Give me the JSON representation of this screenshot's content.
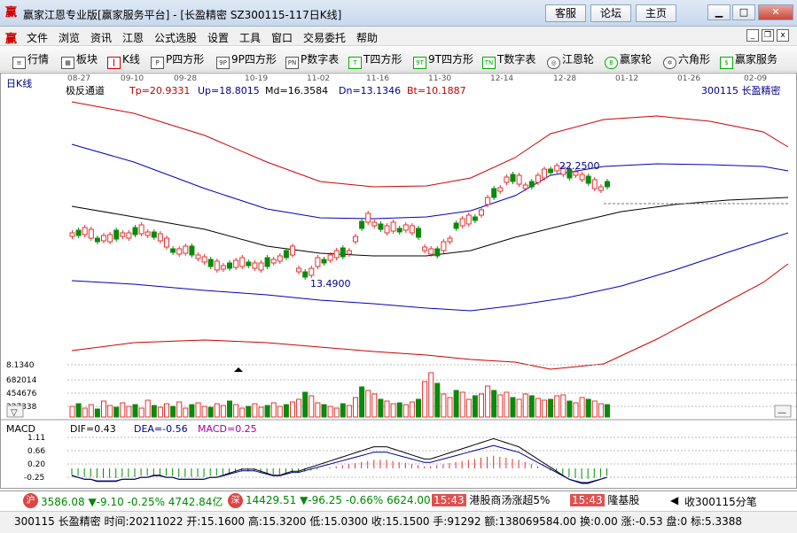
{
  "window": {
    "title": "赢家江恩专业版[赢家服务平台] - [长盈精密  SZ300115-117日K线]",
    "buttons": [
      "客服",
      "论坛",
      "主页"
    ]
  },
  "menu": [
    "文件",
    "浏览",
    "资讯",
    "江恩",
    "公式选股",
    "设置",
    "工具",
    "窗口",
    "交易委托",
    "帮助"
  ],
  "toolbar": [
    {
      "icon": "list-icon",
      "label": "行情"
    },
    {
      "icon": "grid-icon",
      "label": "板块"
    },
    {
      "icon": "candlestick-icon",
      "label": "K线"
    },
    {
      "icon": "p-box-icon",
      "label": "P四方形"
    },
    {
      "icon": "9p-box-icon",
      "label": "9P四方形"
    },
    {
      "icon": "pn-table-icon",
      "label": "P数字表"
    },
    {
      "icon": "t-box-icon",
      "label": "T四方形"
    },
    {
      "icon": "9t-box-icon",
      "label": "9T四方形"
    },
    {
      "icon": "tn-table-icon",
      "label": "T数字表"
    },
    {
      "icon": "wheel-icon",
      "label": "江恩轮"
    },
    {
      "icon": "winner-wheel-icon",
      "label": "赢家轮"
    },
    {
      "icon": "hexagon-icon",
      "label": "六角形"
    },
    {
      "icon": "dollar-icon",
      "label": "赢家服务"
    }
  ],
  "chart": {
    "period_label": "日K线",
    "indicator_name": "极反通道",
    "tp": "Tp=20.9331",
    "up": "Up=18.8015",
    "md": "Md=16.3584",
    "dn": "Dn=13.1346",
    "bt": "Bt=10.1887",
    "stock": "300115  长盈精密",
    "dates": [
      "08-27",
      "09-10",
      "09-28",
      "10-19",
      "11-02",
      "11-16",
      "11-30",
      "12-14",
      "12-28",
      "01-12",
      "01-26",
      "02-09"
    ],
    "high_label": "22.2500",
    "low_label": "13.4900",
    "volume_ticks": [
      "8.1340",
      "682014",
      "454676",
      "227338"
    ],
    "macd_title": "MACD",
    "dif": "DIF=0.43",
    "dea": "DEA=-0.56",
    "macd": "MACD=0.25",
    "macd_ticks": [
      "1.11",
      "0.66",
      "0.20",
      "-0.25"
    ]
  },
  "index_bar": {
    "sh_badge": "沪",
    "sh": "3586.08 ▼-9.10 -0.25% 4742.84亿",
    "sz_badge": "深",
    "sz": "14429.51 ▼-96.25 -0.66% 6624.00",
    "news1_time": "15:43",
    "news1": "港股商汤涨超5%",
    "news2_time": "15:43",
    "news2": "隆基股",
    "news3": "收300115分笔"
  },
  "quote": "300115 长盈精密 时间:20211022 开:15.1600 高:15.3200 低:15.0300 收:15.1500 手:91292 额:138069584.00 换:0.00 涨:-0.53 盘:0 标:5.3388",
  "colors": {
    "up": "#e83030",
    "down": "#0a8a0a",
    "channel_outer": "#cc0000",
    "channel_inner": "#0000bb",
    "mid": "#000000"
  }
}
